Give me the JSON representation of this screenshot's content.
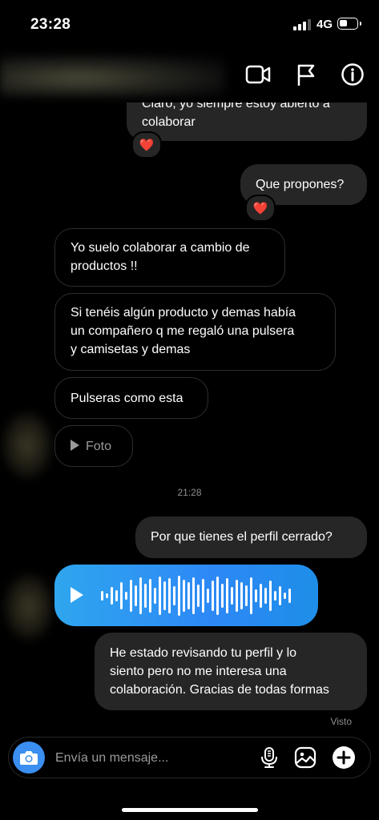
{
  "status_bar": {
    "time": "23:28",
    "network": "4G",
    "battery_level": 0.35
  },
  "header": {
    "icons": [
      "video-call-icon",
      "report-flag-icon",
      "info-icon"
    ]
  },
  "messages": {
    "m0": {
      "direction": "incoming",
      "text_line1": "Claro, yo siempre estoy abierto a",
      "text_line2": "colaborar",
      "reaction": "❤️"
    },
    "m1": {
      "direction": "outgoing",
      "text": "Que propones?",
      "reaction": "❤️"
    },
    "m2": {
      "direction": "incoming",
      "text_line1": "Yo suelo colaborar a cambio de",
      "text_line2": "productos !!"
    },
    "m3": {
      "direction": "incoming",
      "text_line1": "Si tenéis algún producto y demas había",
      "text_line2": "un compañero q me regaló una pulsera",
      "text_line3": "y camisetas y demas"
    },
    "m4": {
      "direction": "incoming",
      "text": "Pulseras como esta"
    },
    "m5": {
      "direction": "incoming",
      "type": "media",
      "label": "Foto"
    },
    "timestamp": "21:28",
    "m6": {
      "direction": "outgoing",
      "text": "Por que tienes el perfil cerrado?"
    },
    "m7": {
      "direction": "incoming",
      "type": "voice",
      "color": "#2d8cf0"
    },
    "m8": {
      "direction": "outgoing",
      "text_line1": "He estado revisando tu perfil y lo",
      "text_line2": "siento pero no me interesa una",
      "text_line3": "colaboración. Gracias de todas formas"
    },
    "seen": "Visto"
  },
  "composer": {
    "placeholder": "Envía un mensaje...",
    "icons": [
      "camera-icon",
      "microphone-icon",
      "gallery-icon",
      "add-icon"
    ]
  },
  "colors": {
    "background": "#000000",
    "bubble": "#262626",
    "accent": "#3a8ff0",
    "meta_text": "#8e8e8e"
  }
}
